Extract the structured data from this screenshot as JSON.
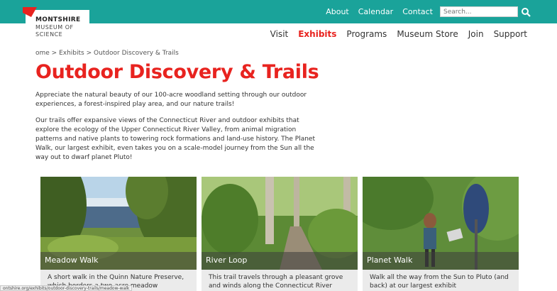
{
  "top_links": [
    "About",
    "Calendar",
    "Contact"
  ],
  "search": {
    "placeholder": "Search..."
  },
  "logo": {
    "line1": "MONTSHIRE",
    "line2": "MUSEUM OF",
    "line3": "SCIENCE"
  },
  "main_nav": [
    "Visit",
    "Exhibits",
    "Programs",
    "Museum Store",
    "Join",
    "Support"
  ],
  "breadcrumb": "ome > Exhibits > Outdoor Discovery & Trails",
  "page_title": "Outdoor Discovery & Trails",
  "intro": "Appreciate the natural beauty of our 100-acre woodland setting through our outdoor experiences, a forest-inspired play area, and our nature trails!",
  "body": "Our trails offer expansive views of the Connecticut River and outdoor exhibits that explore the ecology of the Upper Connecticut River Valley, from animal migration patterns and native plants to towering rock formations and land-use history. The Planet Walk, our largest exhibit, even takes you on a scale-model journey from the Sun all the way out to dwarf planet Pluto!",
  "cards": [
    {
      "title": "Meadow Walk",
      "desc": "A short walk in the Quinn Nature Preserve, which borders a two-acre meadow"
    },
    {
      "title": "River Loop",
      "desc": "This trail travels through a pleasant grove and winds along the Connecticut River"
    },
    {
      "title": "Planet Walk",
      "desc": "Walk all the way from the Sun to Pluto (and back) at our largest exhibit"
    }
  ],
  "status_url": "ontshire.org/exhibits/outdoor-discovery-trails/meadow-walk",
  "colors": {
    "brand_red": "#e8231f",
    "teal": "#1aa39a"
  }
}
